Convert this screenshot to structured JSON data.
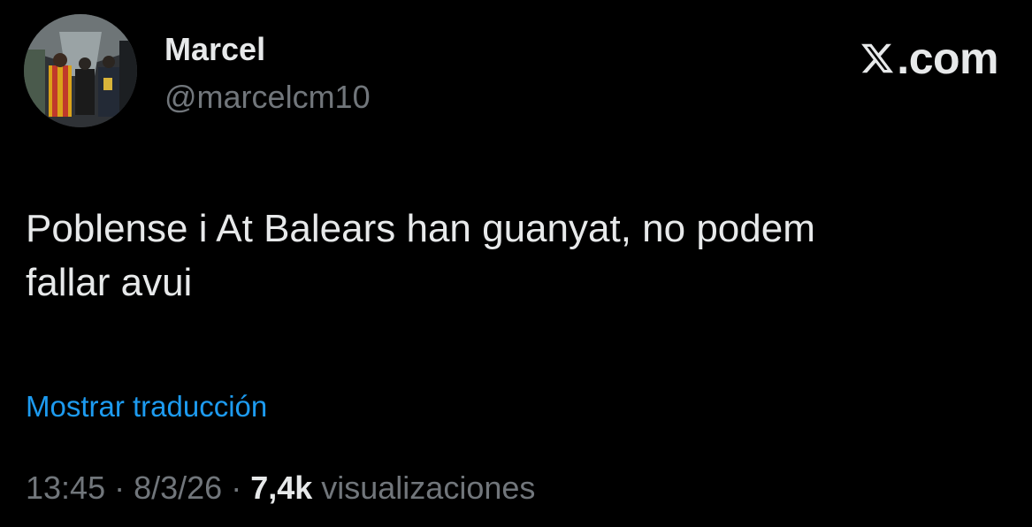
{
  "author": {
    "display_name": "Marcel",
    "handle": "@marcelcm10",
    "avatar_icon": "profile-photo"
  },
  "brand": {
    "text": ".com",
    "logo_icon": "x-logo-icon"
  },
  "tweet": {
    "text_line1": "Poblense i At Balears han guanyat, no podem",
    "text_line2": "fallar avui"
  },
  "translate_link": "Mostrar traducción",
  "meta": {
    "time": "13:45",
    "separator1": " · ",
    "date": "8/3/26",
    "separator2": " · ",
    "views_count": "7,4k",
    "views_label": " visualizaciones"
  },
  "colors": {
    "background": "#000000",
    "primary_text": "#e7e9ea",
    "secondary_text": "#71767b",
    "link": "#1d9bf0"
  }
}
